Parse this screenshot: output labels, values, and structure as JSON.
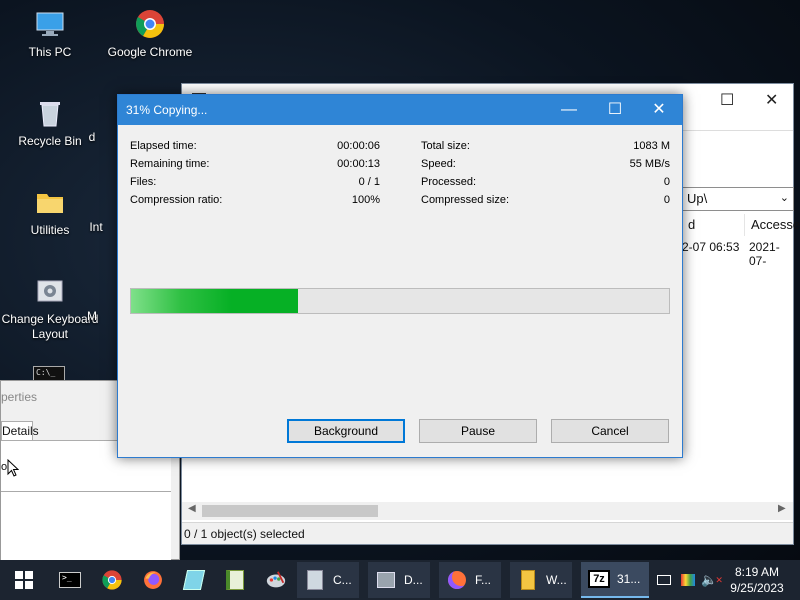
{
  "desktop": {
    "icons": [
      {
        "label": "This PC"
      },
      {
        "label": "Google Chrome"
      },
      {
        "label": "Recycle Bin"
      },
      {
        "label": "Utilities"
      },
      {
        "label": "Change Keyboard Layout"
      },
      {
        "label": "d"
      },
      {
        "label": "Int"
      },
      {
        "label": "M"
      }
    ]
  },
  "background_window": {
    "address": "Up\\",
    "columns": [
      "d",
      "Accesse"
    ],
    "row": {
      "modified": "2-07 06:53",
      "accessed": "2021-07-"
    },
    "status": "0 / 1 object(s) selected"
  },
  "properties_window": {
    "title": "perties",
    "tab": "Details",
    "partial_text": "op"
  },
  "dialog": {
    "title": "31% Copying...",
    "progress": 0.31,
    "left_stats": [
      {
        "label": "Elapsed time:",
        "value": "00:00:06"
      },
      {
        "label": "Remaining time:",
        "value": "00:00:13"
      },
      {
        "label": "Files:",
        "value": "0 / 1"
      },
      {
        "label": "Compression ratio:",
        "value": "100%"
      }
    ],
    "right_stats": [
      {
        "label": "Total size:",
        "value": "1083 M"
      },
      {
        "label": "Speed:",
        "value": "55 MB/s"
      },
      {
        "label": "Processed:",
        "value": "0"
      },
      {
        "label": "Compressed size:",
        "value": "0"
      }
    ],
    "buttons": {
      "background": "Background",
      "pause": "Pause",
      "cancel": "Cancel"
    }
  },
  "taskbar": {
    "apps": [
      {
        "label": "C..."
      },
      {
        "label": "D..."
      },
      {
        "label": "F..."
      },
      {
        "label": "W..."
      },
      {
        "label": "31..."
      }
    ],
    "clock": {
      "time": "8:19 AM",
      "date": "9/25/2023"
    }
  },
  "colors": {
    "accent": "#2f85d6",
    "progress": "#06b025",
    "taskbar": "#1c2430"
  }
}
